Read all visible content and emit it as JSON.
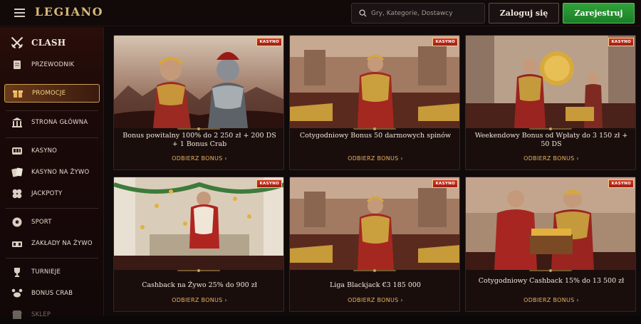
{
  "topbar": {
    "logo": "LEGIANO",
    "search_placeholder": "Gry, Kategorie, Dostawcy",
    "login_label": "Zaloguj się",
    "register_label": "Zarejestruj"
  },
  "sidebar": {
    "items": [
      {
        "label": "CLASH",
        "icon": "crossed-swords-icon"
      },
      {
        "label": "PRZEWODNIK",
        "icon": "scroll-icon"
      },
      {
        "label": "PROMOCJE",
        "icon": "gift-icon"
      },
      {
        "label": "STRONA GŁÓWNA",
        "icon": "temple-icon"
      },
      {
        "label": "KASYNO",
        "icon": "slot-machine-icon"
      },
      {
        "label": "KASYNO NA ŻYWO",
        "icon": "playing-cards-icon"
      },
      {
        "label": "JACKPOTY",
        "icon": "clover-icon"
      },
      {
        "label": "SPORT",
        "icon": "soccer-ball-icon"
      },
      {
        "label": "ZAKŁADY NA ŻYWO",
        "icon": "live-betting-icon"
      },
      {
        "label": "TURNIEJE",
        "icon": "trophy-icon"
      },
      {
        "label": "BONUS CRAB",
        "icon": "crab-icon"
      },
      {
        "label": "SKLEP",
        "icon": "shop-icon"
      }
    ]
  },
  "badge_label": "KASYNO",
  "cta_label": "ODBIERZ BONUS",
  "cards": [
    {
      "text": "Bonus powitalny 100% do 2 250 zł + 200 DS + 1 Bonus Crab",
      "scene": "two-warriors"
    },
    {
      "text": "Cotygodniowy Bonus 50 darmowych spinów",
      "scene": "emperor-seated"
    },
    {
      "text": "Weekendowy Bonus od Wpłaty do 3 150 zł + 50 DS",
      "scene": "gold-shield"
    },
    {
      "text": "Cashback na Żywo 25% do 900 zł",
      "scene": "gold-rain"
    },
    {
      "text": "Liga Blackjack €3 185 000",
      "scene": "emperor-seated"
    },
    {
      "text": "Cotygodniowy Cashback 15% do 13 500 zł",
      "scene": "chest"
    }
  ],
  "colors": {
    "accent_gold": "#e7b35c",
    "register_green": "#2fa33a",
    "badge_red": "#d23524"
  }
}
